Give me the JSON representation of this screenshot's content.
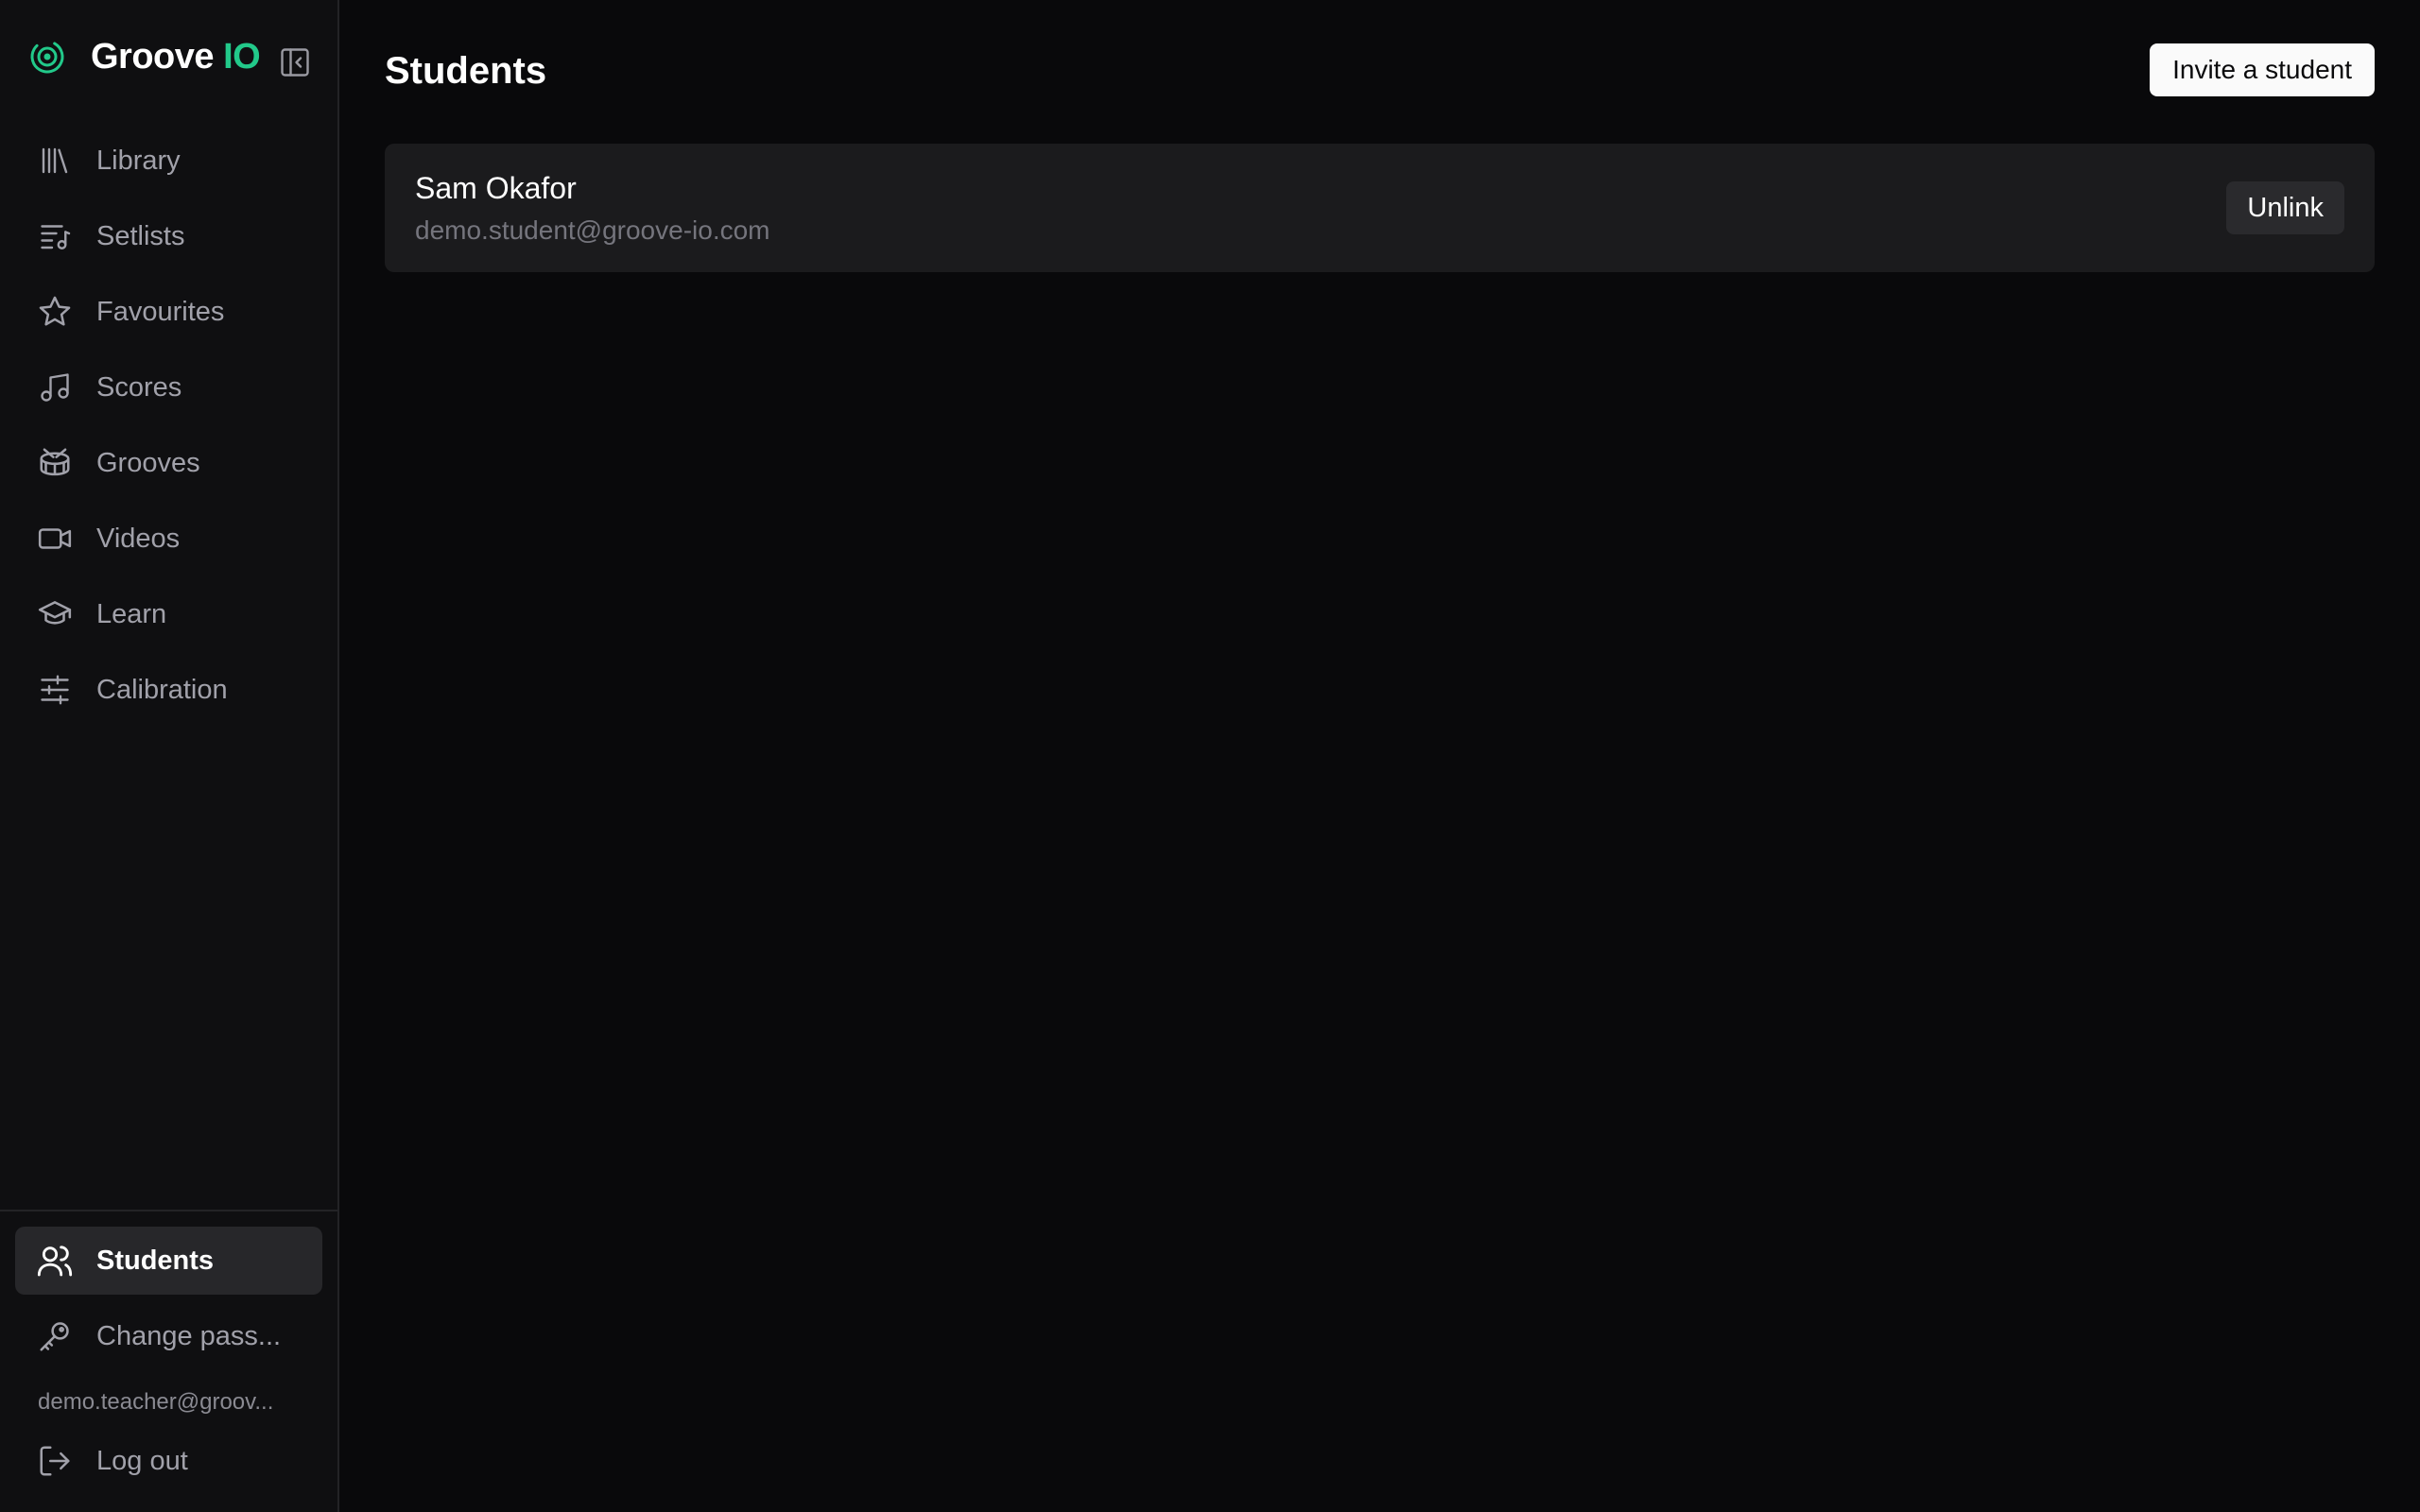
{
  "brand": {
    "name": "Groove",
    "accent": "IO",
    "accent_color": "#22c98a"
  },
  "sidebar": {
    "collapse_icon": "panel-left-collapse-icon",
    "items": [
      {
        "label": "Library",
        "icon": "library-icon"
      },
      {
        "label": "Setlists",
        "icon": "list-music-icon"
      },
      {
        "label": "Favourites",
        "icon": "star-icon"
      },
      {
        "label": "Scores",
        "icon": "music-note-icon"
      },
      {
        "label": "Grooves",
        "icon": "drum-icon"
      },
      {
        "label": "Videos",
        "icon": "video-icon"
      },
      {
        "label": "Learn",
        "icon": "graduation-cap-icon"
      },
      {
        "label": "Calibration",
        "icon": "sliders-icon"
      }
    ],
    "bottom": {
      "students": {
        "label": "Students",
        "icon": "users-icon",
        "active": true
      },
      "change_password": {
        "label": "Change pass...",
        "icon": "key-icon"
      },
      "user_email": "demo.teacher@groov...",
      "logout": {
        "label": "Log out",
        "icon": "log-out-icon"
      }
    }
  },
  "main": {
    "title": "Students",
    "invite_label": "Invite a student",
    "students": [
      {
        "name": "Sam Okafor",
        "email": "demo.student@groove-io.com",
        "action": "Unlink"
      }
    ]
  }
}
